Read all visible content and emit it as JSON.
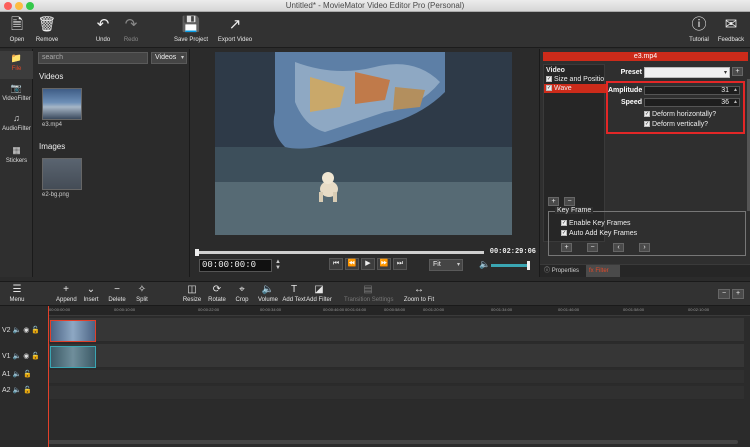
{
  "window": {
    "title": "Untitled* - MovieMator Video Editor Pro (Personal)"
  },
  "toolbar": {
    "open": "Open",
    "remove": "Remove",
    "undo": "Undo",
    "redo": "Redo",
    "save_project": "Save Project",
    "export_video": "Export Video",
    "tutorial": "Tutorial",
    "feedback": "Feedback"
  },
  "nav": {
    "file": "File",
    "video_filter": "VideoFilter",
    "audio_filter": "AudioFilter",
    "stickers": "Stickers"
  },
  "library": {
    "search_placeholder": "search",
    "type_select": "Videos",
    "videos_heading": "Videos",
    "video_item": "e3.mp4",
    "images_heading": "Images",
    "image_item": "e2-bg.png"
  },
  "preview": {
    "total_time": "00:02:29:06",
    "current_time": "00:00:00:0",
    "zoom": "Fit"
  },
  "properties": {
    "clip_name": "e3.mp4",
    "filter_list": {
      "header": "Video",
      "items": [
        "Size and Positio",
        "Wave"
      ]
    },
    "preset_label": "Preset",
    "amplitude_label": "Amplitude",
    "amplitude_value": "31",
    "speed_label": "Speed",
    "speed_value": "36",
    "deform_h": "Deform horizontally?",
    "deform_v": "Deform vertically?",
    "key_frame": {
      "legend": "Key Frame",
      "enable": "Enable Key Frames",
      "auto_add": "Auto Add Key Frames"
    },
    "tabs": {
      "properties": "Properties",
      "filter": "Filter"
    }
  },
  "timeline_toolbar": {
    "menu": "Menu",
    "append": "Append",
    "insert": "Insert",
    "delete": "Delete",
    "split": "Split",
    "resize": "Resize",
    "rotate": "Rotate",
    "crop": "Crop",
    "volume": "Volume",
    "add_text": "Add Text",
    "add_filter": "Add Filter",
    "transition_settings": "Transition Settings",
    "zoom_to_fit": "Zoom to Fit"
  },
  "tracks": {
    "v2": "V2",
    "v1": "V1",
    "a1": "A1",
    "a2": "A2",
    "ruler": [
      "00:00:00:00",
      "00:00:10:00",
      "00:00:22:00",
      "00:00:34:00",
      "00:00:46:00",
      "00:00:58:00",
      "00:01:04:00",
      "00:01:20:00",
      "00:01:34:00",
      "00:01:46:00",
      "00:01:58:00",
      "00:02:10:00"
    ]
  }
}
